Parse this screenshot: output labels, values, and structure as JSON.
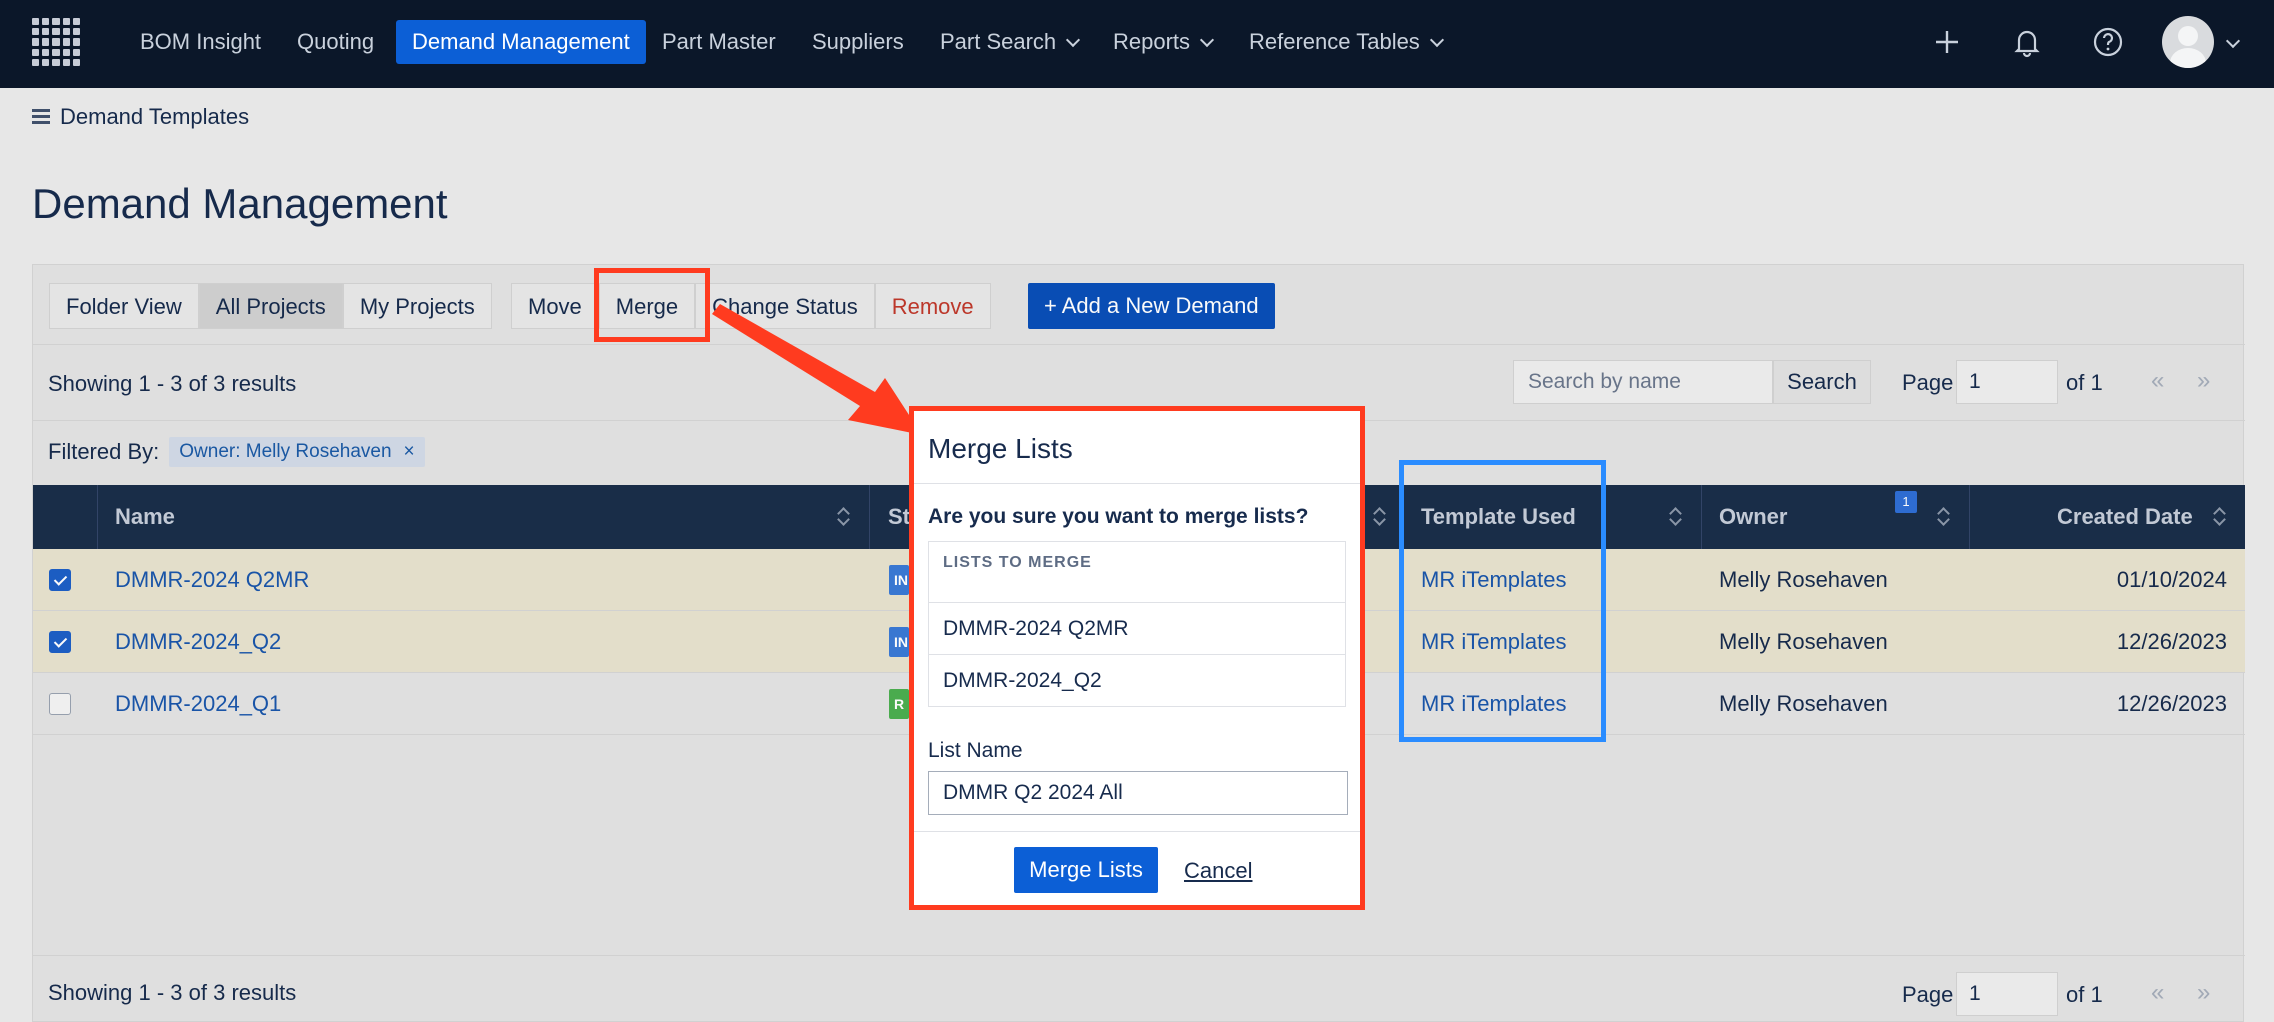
{
  "nav": {
    "items": [
      {
        "label": "BOM Insight"
      },
      {
        "label": "Quoting"
      },
      {
        "label": "Demand Management"
      },
      {
        "label": "Part Master"
      },
      {
        "label": "Suppliers"
      },
      {
        "label": "Part Search"
      },
      {
        "label": "Reports"
      },
      {
        "label": "Reference Tables"
      }
    ],
    "icons": [
      "plus-icon",
      "bell-icon",
      "help-icon"
    ]
  },
  "breadcrumb": {
    "label": "Demand Templates"
  },
  "page": {
    "title": "Demand Management"
  },
  "toolbar": {
    "folder_view": "Folder View",
    "all_projects": "All Projects",
    "my_projects": "My Projects",
    "move": "Move",
    "merge": "Merge",
    "change_status": "Change Status",
    "remove": "Remove",
    "add_new": "+ Add a New Demand"
  },
  "results": {
    "text": "Showing 1 - 3 of 3 results",
    "search_placeholder": "Search by name",
    "search_button": "Search",
    "page_label": "Page",
    "page_value": "1",
    "of_label": "of 1",
    "prev": "«",
    "next": "»"
  },
  "filter": {
    "label": "Filtered By:",
    "chip": "Owner: Melly Rosehaven",
    "chip_close": "×"
  },
  "table": {
    "headers": {
      "name": "Name",
      "status": "St",
      "template": "Template Used",
      "owner": "Owner",
      "created": "Created Date",
      "owner_filter_count": "1"
    },
    "rows": [
      {
        "name": "DMMR-2024 Q2MR",
        "status": "IN",
        "template": "MR iTemplates",
        "owner": "Melly Rosehaven",
        "created": "01/10/2024",
        "checked": true
      },
      {
        "name": "DMMR-2024_Q2",
        "status": "IN",
        "template": "MR iTemplates",
        "owner": "Melly Rosehaven",
        "created": "12/26/2023",
        "checked": true
      },
      {
        "name": "DMMR-2024_Q1",
        "status": "R",
        "template": "MR iTemplates",
        "owner": "Melly Rosehaven",
        "created": "12/26/2023",
        "checked": false
      }
    ]
  },
  "modal": {
    "title": "Merge Lists",
    "question": "Are you sure you want to merge lists?",
    "lists_header": "LISTS TO MERGE",
    "lists": [
      "DMMR-2024 Q2MR",
      "DMMR-2024_Q2"
    ],
    "list_name_label": "List Name",
    "list_name_value": "DMMR Q2 2024 All",
    "merge_button": "Merge Lists",
    "cancel": "Cancel"
  },
  "colors": {
    "nav_bg": "#0b1729",
    "accent": "#0c5fd6",
    "annotation_red": "#ff3b1f",
    "annotation_blue": "#2a8cff",
    "status_in": "#3b7ad6",
    "status_r": "#4caf50"
  }
}
